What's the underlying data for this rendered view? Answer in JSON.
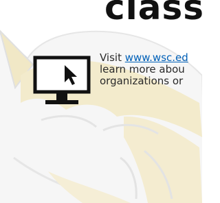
{
  "header": {
    "heading_fragment": "class"
  },
  "info": {
    "icon": "monitor-cursor-icon",
    "prefix": "Visit ",
    "link_text": "www.wsc.ed",
    "line2": "learn more abou",
    "line3": "organizations or"
  },
  "background": {
    "watermark": "wildcat-mascot-watermark"
  },
  "colors": {
    "watermark_fill": "#f3ebcc",
    "watermark_stroke": "#e2e2e2",
    "text": "#2a2a2a",
    "link": "#0060b8",
    "icon": "#111111"
  }
}
